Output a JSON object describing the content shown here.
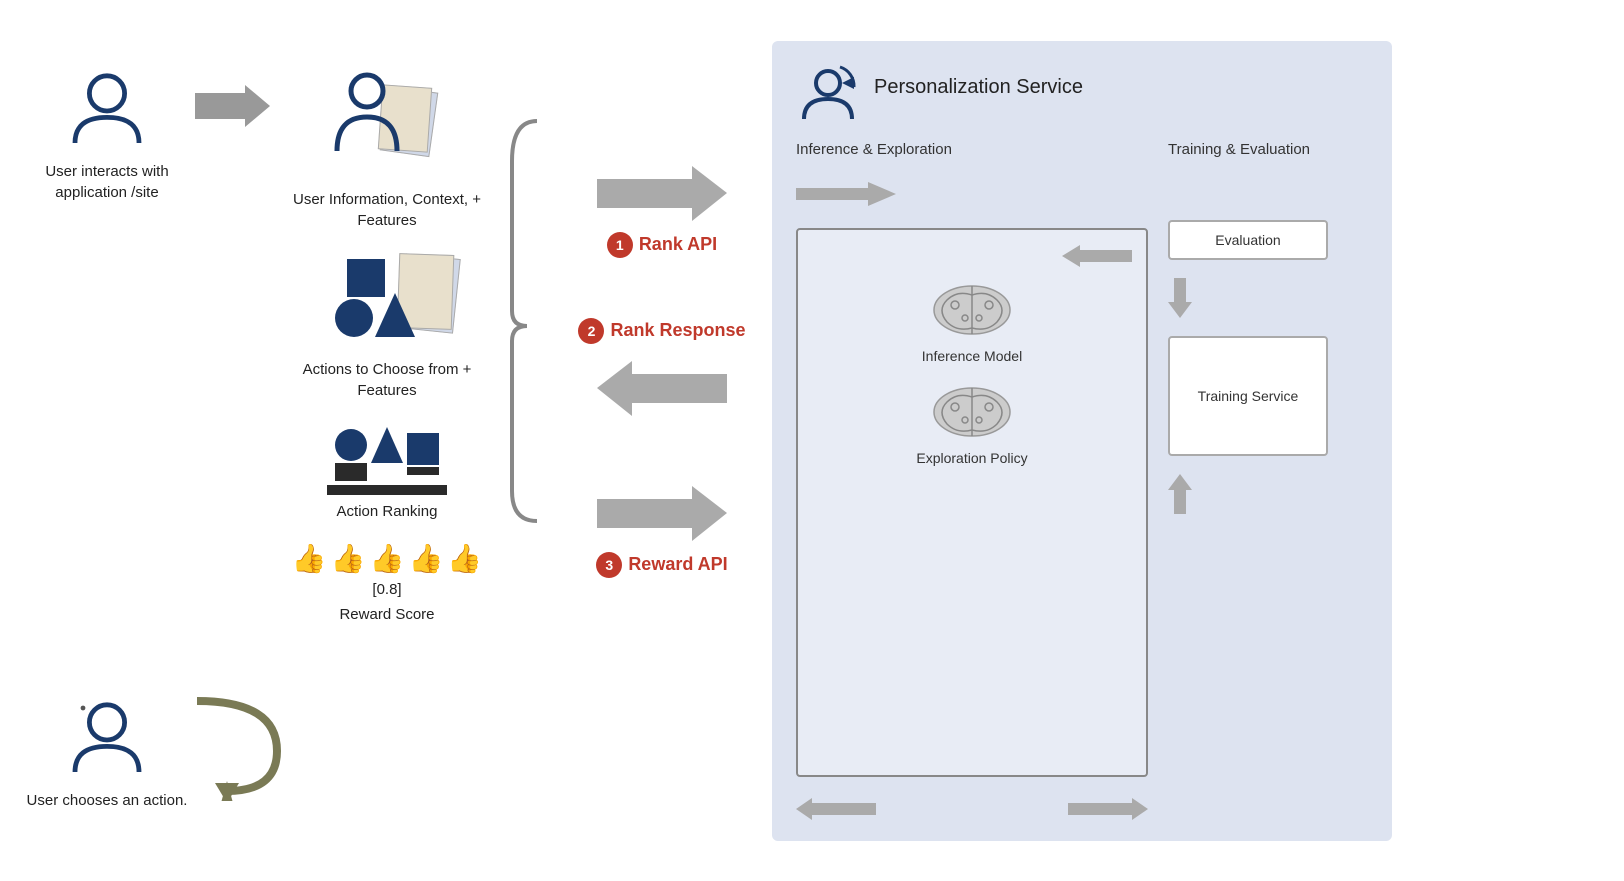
{
  "left_top": {
    "label": "User interacts with application /site"
  },
  "left_bottom": {
    "label": "User chooses an action."
  },
  "features": {
    "user_info_label": "User Information, Context,  + Features",
    "actions_label": "Actions to Choose from + Features",
    "ranking_label": "Action Ranking",
    "reward_score_label": "Reward Score",
    "reward_value": "[0.8]"
  },
  "apis": {
    "rank_api": "Rank API",
    "rank_response": "Rank Response",
    "reward_api": "Reward API",
    "num1": "1",
    "num2": "2",
    "num3": "3"
  },
  "ps": {
    "title": "Personalization Service",
    "inference_label": "Inference &\nExploration",
    "training_label": "Training &\nEvaluation",
    "evaluation_box": "Evaluation",
    "inference_model_label": "Inference Model",
    "exploration_policy_label": "Exploration Policy",
    "training_service_label": "Training Service"
  }
}
